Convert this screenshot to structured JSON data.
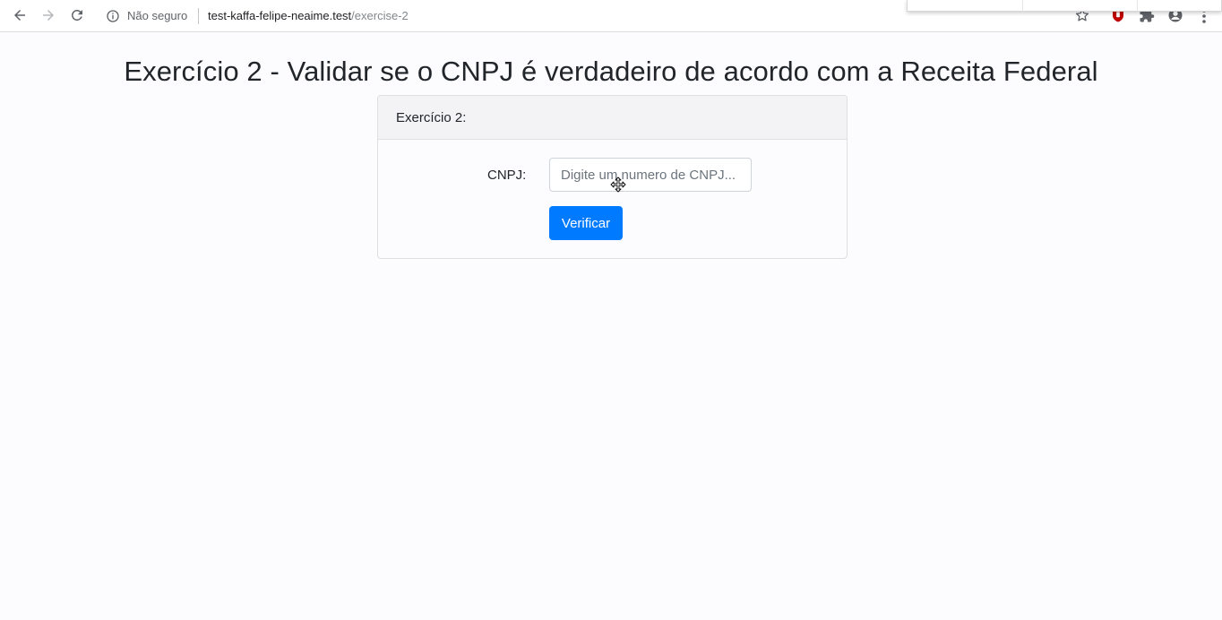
{
  "browser": {
    "security_label": "Não seguro",
    "url_host": "test-kaffa-felipe-neaime.test",
    "url_path": "/exercise-2",
    "icons": [
      "back-icon",
      "forward-icon",
      "reload-icon",
      "info-icon",
      "star-icon",
      "ublock-extension-icon",
      "puzzle-extensions-icon",
      "profile-icon",
      "menu-icon"
    ]
  },
  "page": {
    "title": "Exercício 2 - Validar se o CNPJ é verdadeiro de acordo com a Receita Federal",
    "card": {
      "header": "Exercício 2:",
      "cnpj_label": "CNPJ:",
      "cnpj_placeholder": "Digite um numero de CNPJ...",
      "cnpj_value": "",
      "verify_label": "Verificar"
    }
  },
  "colors": {
    "primary": "#007bff",
    "page_background": "#fcfcfe",
    "card_header_background": "#f3f3f5"
  }
}
